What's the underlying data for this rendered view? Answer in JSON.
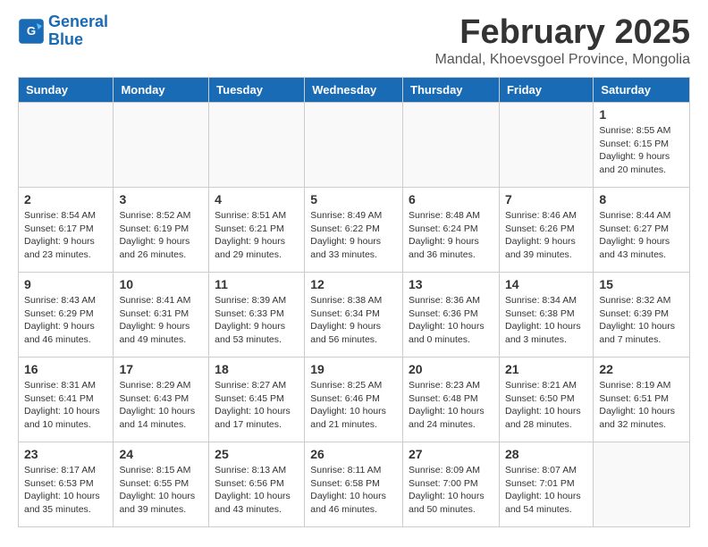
{
  "header": {
    "logo_line1": "General",
    "logo_line2": "Blue",
    "month_title": "February 2025",
    "subtitle": "Mandal, Khoevsgoel Province, Mongolia"
  },
  "weekdays": [
    "Sunday",
    "Monday",
    "Tuesday",
    "Wednesday",
    "Thursday",
    "Friday",
    "Saturday"
  ],
  "weeks": [
    [
      {
        "day": "",
        "info": ""
      },
      {
        "day": "",
        "info": ""
      },
      {
        "day": "",
        "info": ""
      },
      {
        "day": "",
        "info": ""
      },
      {
        "day": "",
        "info": ""
      },
      {
        "day": "",
        "info": ""
      },
      {
        "day": "1",
        "info": "Sunrise: 8:55 AM\nSunset: 6:15 PM\nDaylight: 9 hours\nand 20 minutes."
      }
    ],
    [
      {
        "day": "2",
        "info": "Sunrise: 8:54 AM\nSunset: 6:17 PM\nDaylight: 9 hours\nand 23 minutes."
      },
      {
        "day": "3",
        "info": "Sunrise: 8:52 AM\nSunset: 6:19 PM\nDaylight: 9 hours\nand 26 minutes."
      },
      {
        "day": "4",
        "info": "Sunrise: 8:51 AM\nSunset: 6:21 PM\nDaylight: 9 hours\nand 29 minutes."
      },
      {
        "day": "5",
        "info": "Sunrise: 8:49 AM\nSunset: 6:22 PM\nDaylight: 9 hours\nand 33 minutes."
      },
      {
        "day": "6",
        "info": "Sunrise: 8:48 AM\nSunset: 6:24 PM\nDaylight: 9 hours\nand 36 minutes."
      },
      {
        "day": "7",
        "info": "Sunrise: 8:46 AM\nSunset: 6:26 PM\nDaylight: 9 hours\nand 39 minutes."
      },
      {
        "day": "8",
        "info": "Sunrise: 8:44 AM\nSunset: 6:27 PM\nDaylight: 9 hours\nand 43 minutes."
      }
    ],
    [
      {
        "day": "9",
        "info": "Sunrise: 8:43 AM\nSunset: 6:29 PM\nDaylight: 9 hours\nand 46 minutes."
      },
      {
        "day": "10",
        "info": "Sunrise: 8:41 AM\nSunset: 6:31 PM\nDaylight: 9 hours\nand 49 minutes."
      },
      {
        "day": "11",
        "info": "Sunrise: 8:39 AM\nSunset: 6:33 PM\nDaylight: 9 hours\nand 53 minutes."
      },
      {
        "day": "12",
        "info": "Sunrise: 8:38 AM\nSunset: 6:34 PM\nDaylight: 9 hours\nand 56 minutes."
      },
      {
        "day": "13",
        "info": "Sunrise: 8:36 AM\nSunset: 6:36 PM\nDaylight: 10 hours\nand 0 minutes."
      },
      {
        "day": "14",
        "info": "Sunrise: 8:34 AM\nSunset: 6:38 PM\nDaylight: 10 hours\nand 3 minutes."
      },
      {
        "day": "15",
        "info": "Sunrise: 8:32 AM\nSunset: 6:39 PM\nDaylight: 10 hours\nand 7 minutes."
      }
    ],
    [
      {
        "day": "16",
        "info": "Sunrise: 8:31 AM\nSunset: 6:41 PM\nDaylight: 10 hours\nand 10 minutes."
      },
      {
        "day": "17",
        "info": "Sunrise: 8:29 AM\nSunset: 6:43 PM\nDaylight: 10 hours\nand 14 minutes."
      },
      {
        "day": "18",
        "info": "Sunrise: 8:27 AM\nSunset: 6:45 PM\nDaylight: 10 hours\nand 17 minutes."
      },
      {
        "day": "19",
        "info": "Sunrise: 8:25 AM\nSunset: 6:46 PM\nDaylight: 10 hours\nand 21 minutes."
      },
      {
        "day": "20",
        "info": "Sunrise: 8:23 AM\nSunset: 6:48 PM\nDaylight: 10 hours\nand 24 minutes."
      },
      {
        "day": "21",
        "info": "Sunrise: 8:21 AM\nSunset: 6:50 PM\nDaylight: 10 hours\nand 28 minutes."
      },
      {
        "day": "22",
        "info": "Sunrise: 8:19 AM\nSunset: 6:51 PM\nDaylight: 10 hours\nand 32 minutes."
      }
    ],
    [
      {
        "day": "23",
        "info": "Sunrise: 8:17 AM\nSunset: 6:53 PM\nDaylight: 10 hours\nand 35 minutes."
      },
      {
        "day": "24",
        "info": "Sunrise: 8:15 AM\nSunset: 6:55 PM\nDaylight: 10 hours\nand 39 minutes."
      },
      {
        "day": "25",
        "info": "Sunrise: 8:13 AM\nSunset: 6:56 PM\nDaylight: 10 hours\nand 43 minutes."
      },
      {
        "day": "26",
        "info": "Sunrise: 8:11 AM\nSunset: 6:58 PM\nDaylight: 10 hours\nand 46 minutes."
      },
      {
        "day": "27",
        "info": "Sunrise: 8:09 AM\nSunset: 7:00 PM\nDaylight: 10 hours\nand 50 minutes."
      },
      {
        "day": "28",
        "info": "Sunrise: 8:07 AM\nSunset: 7:01 PM\nDaylight: 10 hours\nand 54 minutes."
      },
      {
        "day": "",
        "info": ""
      }
    ]
  ]
}
